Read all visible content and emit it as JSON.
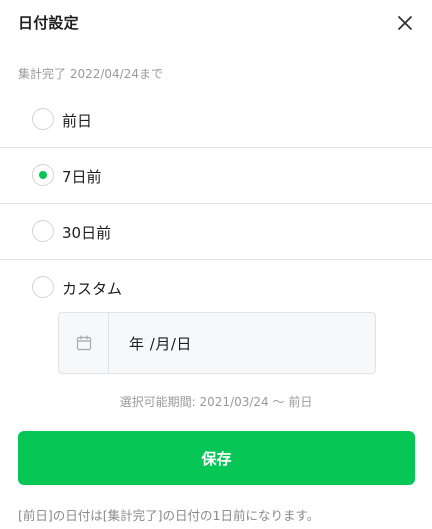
{
  "dialog": {
    "title": "日付設定",
    "close_icon": "close-icon"
  },
  "status_text": "集計完了 2022/04/24まで",
  "options": [
    {
      "label": "前日",
      "selected": false
    },
    {
      "label": "7日前",
      "selected": true
    },
    {
      "label": "30日前",
      "selected": false
    },
    {
      "label": "カスタム",
      "selected": false
    }
  ],
  "date_input": {
    "placeholder": "年 /月/日",
    "icon": "calendar-icon"
  },
  "range_text": "選択可能期間: 2021/03/24 〜 前日",
  "save_label": "保存",
  "note": "[前日]の日付は[集計完了]の日付の1日前になります。",
  "colors": {
    "accent": "#06c755",
    "muted_text": "#9a9a9a",
    "divider": "#e4e4e4"
  }
}
